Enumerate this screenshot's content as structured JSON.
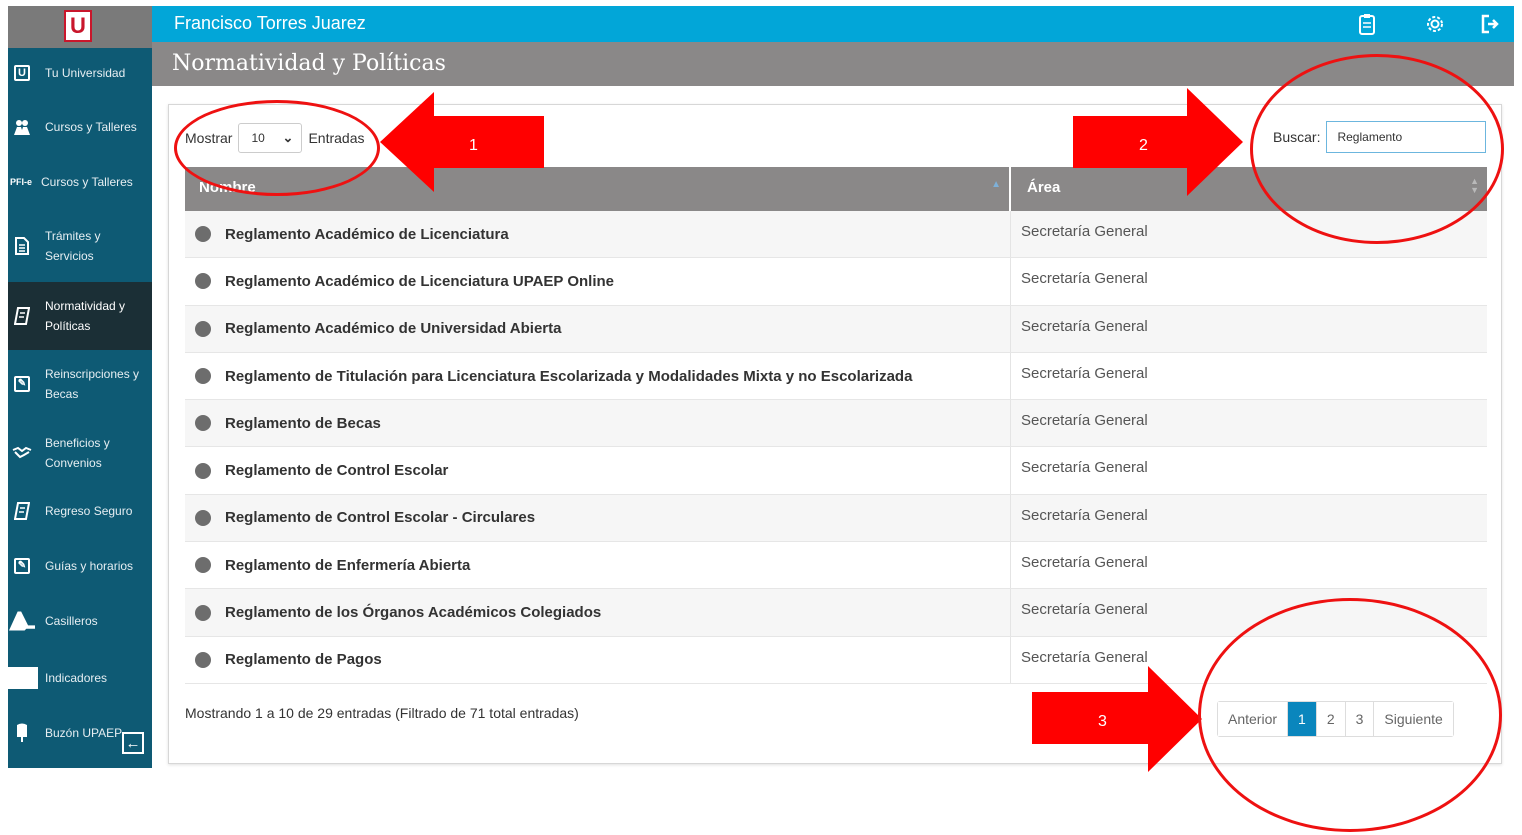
{
  "app": {
    "logo_letter": "U",
    "user_name": "Francisco Torres Juarez",
    "page_title": "Normatividad y Políticas"
  },
  "topbar": {
    "icons": [
      "clipboard-icon",
      "gear-icon",
      "logout-icon"
    ]
  },
  "sidebar": {
    "items": [
      {
        "label": "Tu Universidad",
        "icon": "u-icon"
      },
      {
        "label": "Cursos y Talleres",
        "icon": "people-icon"
      },
      {
        "label": "Cursos y Talleres",
        "icon": "pfi-icon",
        "icon_text": "PFI-e"
      },
      {
        "label": "Trámites y Servicios",
        "icon": "document-icon"
      },
      {
        "label": "Normatividad y Políticas",
        "icon": "book-icon",
        "active": true
      },
      {
        "label": "Reinscripciones y Becas",
        "icon": "edit-icon"
      },
      {
        "label": "Beneficios y Convenios",
        "icon": "handshake-icon"
      },
      {
        "label": "Regreso Seguro",
        "icon": "book-icon"
      },
      {
        "label": "Guías y horarios",
        "icon": "edit-icon"
      },
      {
        "label": "Casilleros",
        "icon": "lockers-icon"
      },
      {
        "label": "Indicadores",
        "icon": "chart-icon"
      },
      {
        "label": "Buzón UPAEP",
        "icon": "mailbox-icon"
      }
    ]
  },
  "controls": {
    "show_label": "Mostrar",
    "show_value": "10",
    "entries_label": "Entradas",
    "search_label": "Buscar:",
    "search_value": "Reglamento"
  },
  "table": {
    "headers": [
      "Nombre",
      "Área"
    ],
    "rows": [
      {
        "name": "Reglamento Académico de Licenciatura",
        "area": "Secretaría General"
      },
      {
        "name": "Reglamento Académico de Licenciatura UPAEP Online",
        "area": "Secretaría General"
      },
      {
        "name": "Reglamento Académico de Universidad Abierta",
        "area": "Secretaría General"
      },
      {
        "name": "Reglamento de Titulación para Licenciatura Escolarizada y Modalidades Mixta y no Escolarizada",
        "area": "Secretaría General"
      },
      {
        "name": "Reglamento de Becas",
        "area": "Secretaría General"
      },
      {
        "name": "Reglamento de Control Escolar",
        "area": "Secretaría General"
      },
      {
        "name": "Reglamento de Control Escolar - Circulares",
        "area": "Secretaría General"
      },
      {
        "name": "Reglamento de Enfermería Abierta",
        "area": "Secretaría General"
      },
      {
        "name": "Reglamento de los Órganos Académicos Colegiados",
        "area": "Secretaría General"
      },
      {
        "name": "Reglamento de Pagos",
        "area": "Secretaría General"
      }
    ]
  },
  "footer": {
    "info": "Mostrando 1 a 10 de 29 entradas (Filtrado de 71 total entradas)"
  },
  "pagination": {
    "prev": "Anterior",
    "pages": [
      "1",
      "2",
      "3"
    ],
    "current": "1",
    "next": "Siguiente"
  },
  "annotations": {
    "callouts": [
      "1",
      "2",
      "3"
    ],
    "color": "#ff0000"
  },
  "colors": {
    "sidebar": "#0e5a74",
    "topbar": "#02a6d8",
    "titlebar": "#8a8888",
    "active_page": "#0a86bd"
  }
}
